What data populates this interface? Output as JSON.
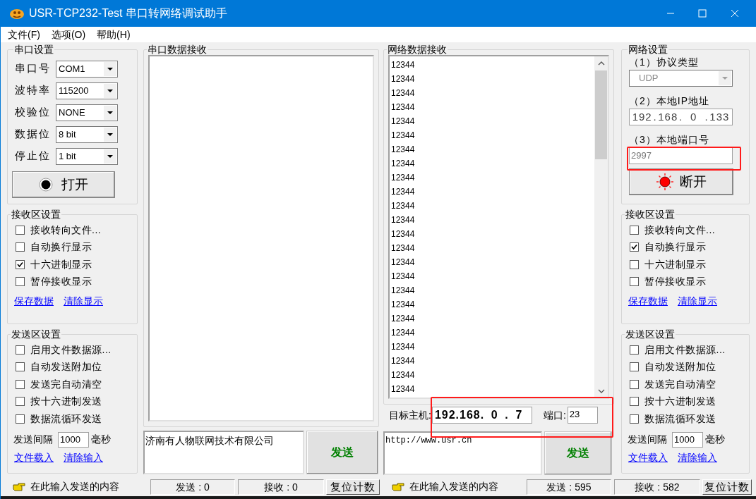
{
  "window": {
    "title": "USR-TCP232-Test 串口转网络调试助手"
  },
  "menu": [
    "文件(F)",
    "选项(O)",
    "帮助(H)"
  ],
  "serial_settings": {
    "title": "串口设置",
    "fields": [
      {
        "label": "串口号",
        "value": "COM1"
      },
      {
        "label": "波特率",
        "value": "115200"
      },
      {
        "label": "校验位",
        "value": "NONE"
      },
      {
        "label": "数据位",
        "value": "8 bit"
      },
      {
        "label": "停止位",
        "value": "1 bit"
      }
    ],
    "button": "打开",
    "port_open": false
  },
  "left_receive_settings": {
    "title": "接收区设置",
    "options": [
      {
        "label": "接收转向文件...",
        "checked": false
      },
      {
        "label": "自动换行显示",
        "checked": false
      },
      {
        "label": "十六进制显示",
        "checked": true
      },
      {
        "label": "暂停接收显示",
        "checked": false
      }
    ],
    "links": [
      "保存数据",
      "清除显示"
    ]
  },
  "left_send_settings": {
    "title": "发送区设置",
    "options": [
      {
        "label": "启用文件数据源...",
        "checked": false
      },
      {
        "label": "自动发送附加位",
        "checked": false
      },
      {
        "label": "发送完自动清空",
        "checked": false
      },
      {
        "label": "按十六进制发送",
        "checked": false
      },
      {
        "label": "数据流循环发送",
        "checked": false
      }
    ],
    "interval_label": "发送间隔",
    "interval": "1000",
    "interval_unit": "毫秒",
    "links": [
      "文件载入",
      "清除输入"
    ]
  },
  "serial_receive": {
    "title": "串口数据接收"
  },
  "serial_send": {
    "value": "济南有人物联网技术有限公司",
    "button": "发送"
  },
  "network_receive": {
    "title": "网络数据接收",
    "lines": [
      "12344",
      "12344",
      "12344",
      "12344",
      "12344",
      "12344",
      "12344",
      "12344",
      "12344",
      "12344",
      "12344",
      "12344",
      "12344",
      "12344",
      "12344",
      "12344",
      "12344",
      "12344",
      "12344",
      "12344",
      "12344",
      "12344",
      "12344",
      "12344"
    ]
  },
  "target": {
    "host_label": "目标主机:",
    "host": [
      "192",
      "168",
      "0",
      "7"
    ],
    "host_separator": ".",
    "port_label": "端口:",
    "port": "23"
  },
  "network_send": {
    "value": "http://www.usr.cn",
    "button": "发送"
  },
  "network_settings": {
    "title": "网络设置",
    "protocol_label": "（1）协议类型",
    "protocol": "UDP",
    "ip_label": "（2）本地IP地址",
    "ip": [
      "192",
      "168",
      "0",
      "133"
    ],
    "ip_separator": ".",
    "port_label": "（3）本地端口号",
    "port": "2997",
    "button": "断开",
    "connected": true
  },
  "right_receive_settings": {
    "title": "接收区设置",
    "options": [
      {
        "label": "接收转向文件...",
        "checked": false
      },
      {
        "label": "自动换行显示",
        "checked": true
      },
      {
        "label": "十六进制显示",
        "checked": false
      },
      {
        "label": "暂停接收显示",
        "checked": false
      }
    ],
    "links": [
      "保存数据",
      "清除显示"
    ]
  },
  "right_send_settings": {
    "title": "发送区设置",
    "options": [
      {
        "label": "启用文件数据源...",
        "checked": false
      },
      {
        "label": "自动发送附加位",
        "checked": false
      },
      {
        "label": "发送完自动清空",
        "checked": false
      },
      {
        "label": "按十六进制发送",
        "checked": false
      },
      {
        "label": "数据流循环发送",
        "checked": false
      }
    ],
    "interval_label": "发送间隔",
    "interval": "1000",
    "interval_unit": "毫秒",
    "links": [
      "文件载入",
      "清除输入"
    ]
  },
  "status_bar": {
    "left": {
      "hint": "在此输入发送的内容",
      "sent": "发送 : 0",
      "received": "接收 : 0",
      "reset": "复位计数"
    },
    "right": {
      "hint": "在此输入发送的内容",
      "sent": "发送 : 595",
      "received": "接收 : 582",
      "reset": "复位计数"
    }
  }
}
